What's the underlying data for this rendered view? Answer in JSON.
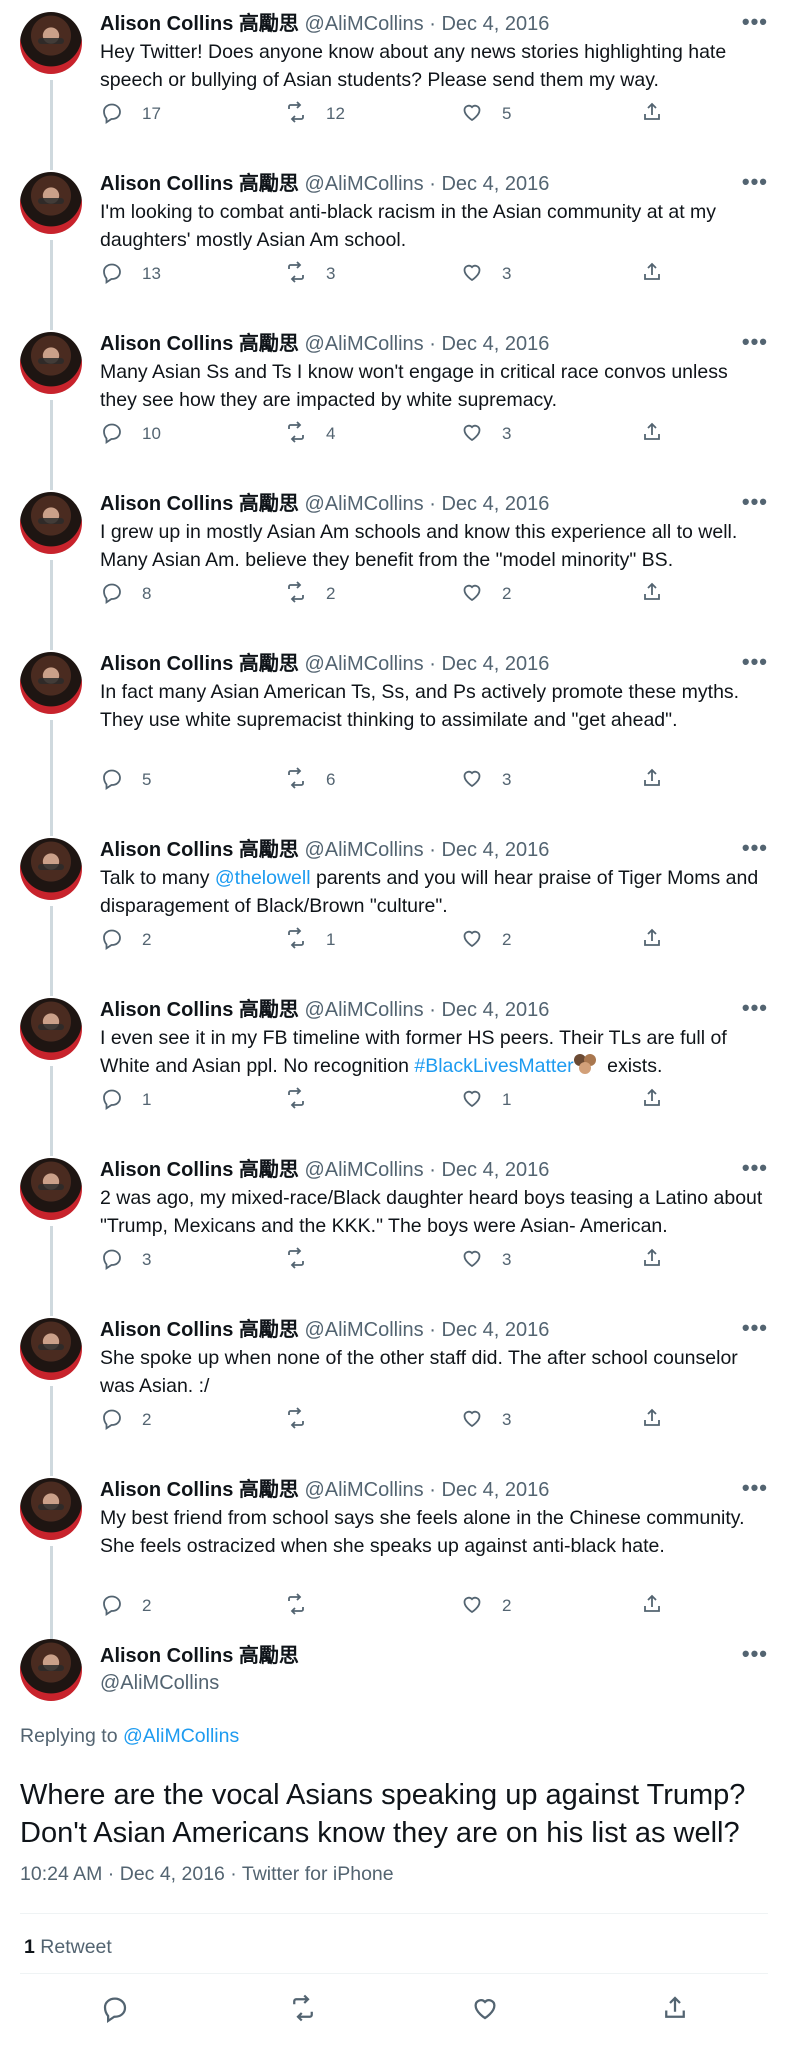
{
  "author": {
    "name": "Alison Collins 高勵思",
    "handle": "@AliMCollins",
    "date": "Dec 4, 2016"
  },
  "tweets": [
    {
      "text": "Hey Twitter! Does anyone know about any news stories highlighting hate speech or bullying of Asian students? Please send them my way.",
      "replies": "17",
      "retweets": "12",
      "likes": "5"
    },
    {
      "text": "I'm looking to combat anti-black racism in the Asian community at at my daughters' mostly Asian Am school.",
      "replies": "13",
      "retweets": "3",
      "likes": "3"
    },
    {
      "text": "Many Asian Ss and Ts I know won't engage in critical race convos unless they see how they are impacted by white supremacy.",
      "replies": "10",
      "retweets": "4",
      "likes": "3"
    },
    {
      "text": "I grew up in mostly Asian Am schools and know this experience all to well. Many Asian Am. believe they benefit from the \"model minority\" BS.",
      "replies": "8",
      "retweets": "2",
      "likes": "2"
    },
    {
      "text": "In fact many Asian American Ts, Ss, and Ps actively promote these myths. They use white supremacist thinking to assimilate and \"get ahead\".",
      "replies": "5",
      "retweets": "6",
      "likes": "3"
    },
    {
      "text_before": "Talk to many ",
      "mention": "@thelowell",
      "text_after": " parents and you will hear praise of Tiger Moms and disparagement of Black/Brown \"culture\".",
      "replies": "2",
      "retweets": "1",
      "likes": "2"
    },
    {
      "text_before": "I even see it in my FB timeline with former HS peers. Their TLs are full of White and Asian ppl. No recognition ",
      "hashtag": "#BlackLivesMatter",
      "text_after": " exists.",
      "replies": "1",
      "retweets": "",
      "likes": "1"
    },
    {
      "text": "2 was ago, my mixed-race/Black daughter heard boys teasing a Latino about \"Trump, Mexicans and the KKK.\" The boys were Asian- American.",
      "replies": "3",
      "retweets": "",
      "likes": "3"
    },
    {
      "text": "She spoke up when none of the other staff did. The after school counselor was Asian. :/",
      "replies": "2",
      "retweets": "",
      "likes": "3"
    },
    {
      "text": "My best friend from school says she feels alone in the Chinese community. She feels ostracized when she speaks up against anti-black hate.",
      "replies": "2",
      "retweets": "",
      "likes": "2"
    }
  ],
  "main_tweet": {
    "replying_label": "Replying to",
    "replying_to": "@AliMCollins",
    "text": "Where are the vocal Asians speaking up against Trump? Don't Asian Americans know they are on his list as well?",
    "time": "10:24 AM",
    "date": "Dec 4, 2016",
    "source": "Twitter for iPhone",
    "retweet_count": "1",
    "retweet_label": "Retweet"
  },
  "icons": {
    "reply": "reply-icon",
    "retweet": "retweet-icon",
    "like": "heart-icon",
    "share": "share-icon",
    "more": "more-icon"
  },
  "colors": {
    "link": "#1d9bf0",
    "muted": "#536471",
    "text": "#0f1419"
  }
}
